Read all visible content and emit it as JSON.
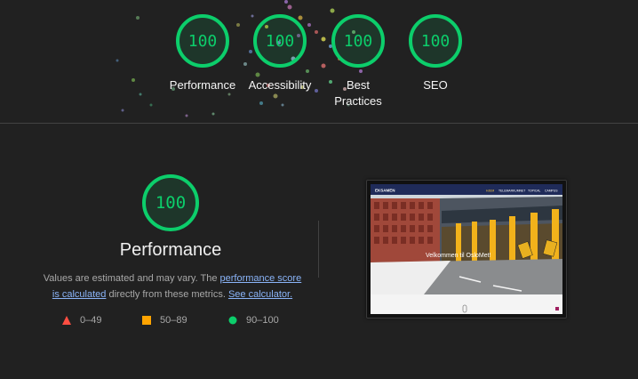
{
  "summary_gauges": [
    {
      "score": "100",
      "label": "Performance"
    },
    {
      "score": "100",
      "label": "Accessibility"
    },
    {
      "score": "100",
      "label": "Best Practices"
    },
    {
      "score": "100",
      "label": "SEO"
    }
  ],
  "performance": {
    "score": "100",
    "title": "Performance",
    "desc_prefix": "Values are estimated and may vary. The ",
    "link_score": "performance score is calculated",
    "desc_mid": " directly from these metrics. ",
    "link_calculator": "See calculator."
  },
  "legend": [
    {
      "range": "0–49",
      "shape": "triangle",
      "color": "#ff4e42"
    },
    {
      "range": "50–89",
      "shape": "square",
      "color": "#ffa400"
    },
    {
      "range": "90–100",
      "shape": "circle",
      "color": "#0cce6b"
    }
  ],
  "screenshot": {
    "brand": "EKSAMEN",
    "nav": [
      "HJEM",
      "TELEMARKUMNET",
      "TOPICAL",
      "CAMPUS"
    ],
    "overlay_text": "Velkommen til OsloMet!"
  },
  "colors": {
    "pass": "#0cce6b",
    "background": "#212121"
  }
}
